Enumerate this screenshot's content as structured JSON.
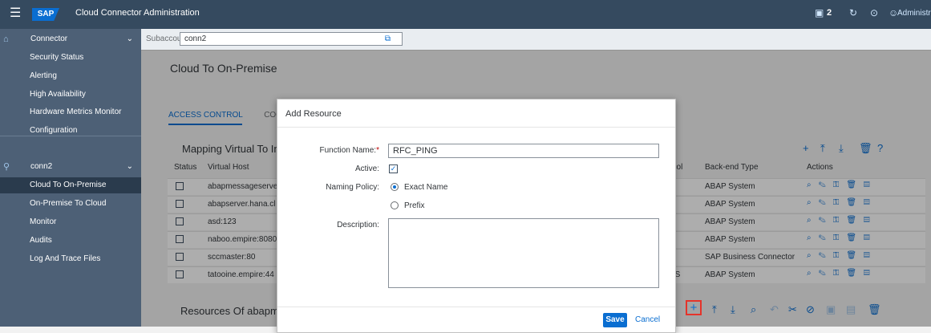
{
  "shell": {
    "menu_icon": "☰",
    "logo": "SAP",
    "title": "Cloud Connector Administration",
    "notifications_count": "2",
    "user": "Administrator"
  },
  "sidebar": {
    "connector_group": "Connector",
    "connector_items": [
      "Security Status",
      "Alerting",
      "High Availability",
      "Hardware Metrics Monitor",
      "Configuration"
    ],
    "subaccount_group": "conn2",
    "subaccount_items": [
      "Cloud To On-Premise",
      "On-Premise To Cloud",
      "Monitor",
      "Audits",
      "Log And Trace Files"
    ],
    "selected_index": 0
  },
  "subaccount": {
    "label": "Subaccount:",
    "value": "conn2"
  },
  "page": {
    "title": "Cloud To On-Premise",
    "tab_access_control": "ACCESS CONTROL",
    "tab_partial": "COO",
    "mapping_title": "Mapping Virtual To In",
    "resources_title": "Resources Of abapm"
  },
  "table": {
    "headers": {
      "status": "Status",
      "virtual_host": "Virtual Host",
      "protocol": "ocol",
      "backend_type": "Back-end Type",
      "actions": "Actions"
    },
    "rows": [
      {
        "virtual_host": "abapmessageserve",
        "protocol": "",
        "backend_type": "ABAP System"
      },
      {
        "virtual_host": "abapserver.hana.cl",
        "protocol": "",
        "backend_type": "ABAP System"
      },
      {
        "virtual_host": "asd:123",
        "protocol": "",
        "backend_type": "ABAP System"
      },
      {
        "virtual_host": "naboo.empire:8080",
        "protocol": "",
        "backend_type": "ABAP System"
      },
      {
        "virtual_host": "sccmaster:80",
        "protocol": "",
        "backend_type": "SAP Business Connector"
      },
      {
        "virtual_host": "tatooine.empire:44",
        "protocol": "PS",
        "backend_type": "ABAP System"
      }
    ]
  },
  "dialog": {
    "title": "Add Resource",
    "function_name_label": "Function Name:",
    "required_mark": "*",
    "function_name_value": "RFC_PING",
    "active_label": "Active:",
    "naming_policy_label": "Naming Policy:",
    "option_exact": "Exact Name",
    "option_prefix": "Prefix",
    "description_label": "Description:",
    "save": "Save",
    "cancel": "Cancel"
  }
}
